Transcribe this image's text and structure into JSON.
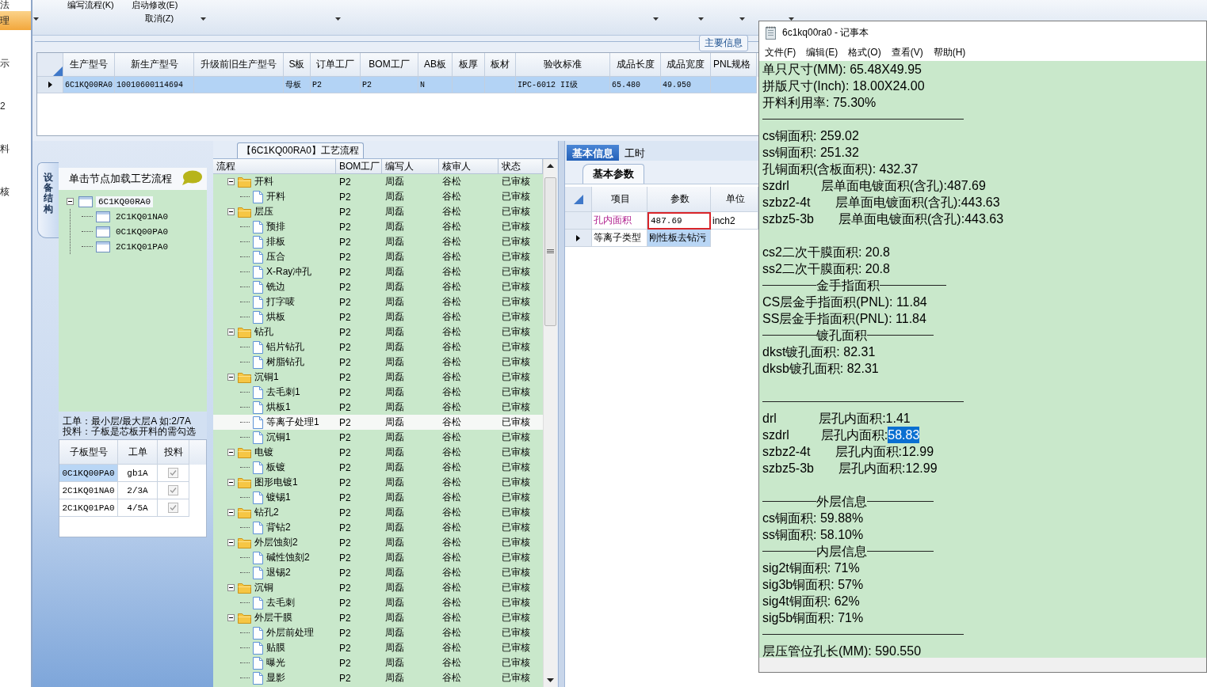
{
  "nav": {
    "items": [
      {
        "label": "法",
        "selected": false
      },
      {
        "label": "理",
        "selected": true
      },
      {
        "label": "示",
        "selected": false
      },
      {
        "label": "2",
        "selected": false
      },
      {
        "label": "料",
        "selected": false
      },
      {
        "label": "核",
        "selected": false
      }
    ]
  },
  "ribbon": {
    "commands": [
      "编写流程(K)",
      "启动修改(E)",
      "取消(Z)"
    ]
  },
  "main_info": {
    "title": "主要信息",
    "columns": [
      "生产型号",
      "新生产型号",
      "升级前旧生产型号",
      "S板",
      "订单工厂",
      "BOM工厂",
      "AB板",
      "板厚",
      "板材",
      "验收标准",
      "成品长度",
      "成品宽度",
      "PNL规格"
    ],
    "rows": [
      {
        "selected": true,
        "cells": [
          "6C1KQ00RA0",
          "10010600114694",
          null,
          "母板",
          "P2",
          "P2",
          "N",
          null,
          null,
          "IPC-6012 II级",
          "65.480",
          "49.950",
          null
        ]
      }
    ]
  },
  "structure_panel": {
    "tab": "设备结构",
    "hint": "单击节点加载工艺流程",
    "tree": [
      {
        "label": "6C1KQ00RA0",
        "expanded": true,
        "selected": true,
        "children": [
          {
            "label": "2C1KQ01NA0",
            "selected": false
          },
          {
            "label": "0C1KQ00PA0",
            "selected": false
          },
          {
            "label": "2C1KQ01PA0",
            "selected": false
          }
        ]
      }
    ],
    "note": [
      "工单：最小层/最大层A 如:2/7A",
      "投料：子板是芯板开料的需勾选"
    ],
    "grid": {
      "columns": [
        "子板型号",
        "工单",
        "投料"
      ],
      "rows": [
        {
          "board": "0C1KQ00PA0",
          "order": "gb1A",
          "checked": true,
          "selected": true
        },
        {
          "board": "2C1KQ01NA0",
          "order": "2/3A",
          "checked": true,
          "selected": false
        },
        {
          "board": "2C1KQ01PA0",
          "order": "4/5A",
          "checked": true,
          "selected": false
        }
      ]
    }
  },
  "process_panel": {
    "title": "【6C1KQ00RA0】工艺流程",
    "columns": [
      "流程",
      "BOM工厂",
      "编写人",
      "核审人",
      "状态"
    ],
    "rows": [
      {
        "label": "开料",
        "kind": "folder",
        "expanded": true,
        "bom": "P2",
        "author": "周磊",
        "reviewer": "谷松",
        "status": "已审核",
        "selected": false,
        "children": [
          {
            "label": "开料",
            "kind": "file",
            "bom": "P2",
            "author": "周磊",
            "reviewer": "谷松",
            "status": "已审核",
            "selected": false
          }
        ]
      },
      {
        "label": "层压",
        "kind": "folder",
        "expanded": true,
        "bom": "P2",
        "author": "周磊",
        "reviewer": "谷松",
        "status": "已审核",
        "selected": false,
        "children": [
          {
            "label": "预排",
            "kind": "file",
            "bom": "P2",
            "author": "周磊",
            "reviewer": "谷松",
            "status": "已审核",
            "selected": false
          },
          {
            "label": "排板",
            "kind": "file",
            "bom": "P2",
            "author": "周磊",
            "reviewer": "谷松",
            "status": "已审核",
            "selected": false
          },
          {
            "label": "压合",
            "kind": "file",
            "bom": "P2",
            "author": "周磊",
            "reviewer": "谷松",
            "status": "已审核",
            "selected": false
          },
          {
            "label": "X-Ray冲孔",
            "kind": "file",
            "bom": "P2",
            "author": "周磊",
            "reviewer": "谷松",
            "status": "已审核",
            "selected": false
          },
          {
            "label": "铣边",
            "kind": "file",
            "bom": "P2",
            "author": "周磊",
            "reviewer": "谷松",
            "status": "已审核",
            "selected": false
          },
          {
            "label": "打字唛",
            "kind": "file",
            "bom": "P2",
            "author": "周磊",
            "reviewer": "谷松",
            "status": "已审核",
            "selected": false
          },
          {
            "label": "烘板",
            "kind": "file",
            "bom": "P2",
            "author": "周磊",
            "reviewer": "谷松",
            "status": "已审核",
            "selected": false
          }
        ]
      },
      {
        "label": "钻孔",
        "kind": "folder",
        "expanded": true,
        "bom": "P2",
        "author": "周磊",
        "reviewer": "谷松",
        "status": "已审核",
        "selected": false,
        "children": [
          {
            "label": "铝片钻孔",
            "kind": "file",
            "bom": "P2",
            "author": "周磊",
            "reviewer": "谷松",
            "status": "已审核",
            "selected": false
          },
          {
            "label": "树脂钻孔",
            "kind": "file",
            "bom": "P2",
            "author": "周磊",
            "reviewer": "谷松",
            "status": "已审核",
            "selected": false
          }
        ]
      },
      {
        "label": "沉铜1",
        "kind": "folder",
        "expanded": true,
        "bom": "P2",
        "author": "周磊",
        "reviewer": "谷松",
        "status": "已审核",
        "selected": false,
        "children": [
          {
            "label": "去毛刺1",
            "kind": "file",
            "bom": "P2",
            "author": "周磊",
            "reviewer": "谷松",
            "status": "已审核",
            "selected": false
          },
          {
            "label": "烘板1",
            "kind": "file",
            "bom": "P2",
            "author": "周磊",
            "reviewer": "谷松",
            "status": "已审核",
            "selected": false
          },
          {
            "label": "等离子处理1",
            "kind": "file",
            "bom": "P2",
            "author": "周磊",
            "reviewer": "谷松",
            "status": "已审核",
            "selected": true
          },
          {
            "label": "沉铜1",
            "kind": "file",
            "bom": "P2",
            "author": "周磊",
            "reviewer": "谷松",
            "status": "已审核",
            "selected": false
          }
        ]
      },
      {
        "label": "电镀",
        "kind": "folder",
        "expanded": true,
        "bom": "P2",
        "author": "周磊",
        "reviewer": "谷松",
        "status": "已审核",
        "selected": false,
        "children": [
          {
            "label": "板镀",
            "kind": "file",
            "bom": "P2",
            "author": "周磊",
            "reviewer": "谷松",
            "status": "已审核",
            "selected": false
          }
        ]
      },
      {
        "label": "图形电镀1",
        "kind": "folder",
        "expanded": true,
        "bom": "P2",
        "author": "周磊",
        "reviewer": "谷松",
        "status": "已审核",
        "selected": false,
        "children": [
          {
            "label": "镀锡1",
            "kind": "file",
            "bom": "P2",
            "author": "周磊",
            "reviewer": "谷松",
            "status": "已审核",
            "selected": false
          }
        ]
      },
      {
        "label": "钻孔2",
        "kind": "folder",
        "expanded": true,
        "bom": "P2",
        "author": "周磊",
        "reviewer": "谷松",
        "status": "已审核",
        "selected": false,
        "children": [
          {
            "label": "背钻2",
            "kind": "file",
            "bom": "P2",
            "author": "周磊",
            "reviewer": "谷松",
            "status": "已审核",
            "selected": false
          }
        ]
      },
      {
        "label": "外层蚀刻2",
        "kind": "folder",
        "expanded": true,
        "bom": "P2",
        "author": "周磊",
        "reviewer": "谷松",
        "status": "已审核",
        "selected": false,
        "children": [
          {
            "label": "碱性蚀刻2",
            "kind": "file",
            "bom": "P2",
            "author": "周磊",
            "reviewer": "谷松",
            "status": "已审核",
            "selected": false
          },
          {
            "label": "退锡2",
            "kind": "file",
            "bom": "P2",
            "author": "周磊",
            "reviewer": "谷松",
            "status": "已审核",
            "selected": false
          }
        ]
      },
      {
        "label": "沉铜",
        "kind": "folder",
        "expanded": true,
        "bom": "P2",
        "author": "周磊",
        "reviewer": "谷松",
        "status": "已审核",
        "selected": false,
        "children": [
          {
            "label": "去毛刺",
            "kind": "file",
            "bom": "P2",
            "author": "周磊",
            "reviewer": "谷松",
            "status": "已审核",
            "selected": false
          }
        ]
      },
      {
        "label": "外层干膜",
        "kind": "folder",
        "expanded": true,
        "bom": "P2",
        "author": "周磊",
        "reviewer": "谷松",
        "status": "已审核",
        "selected": false,
        "children": [
          {
            "label": "外层前处理",
            "kind": "file",
            "bom": "P2",
            "author": "周磊",
            "reviewer": "谷松",
            "status": "已审核",
            "selected": false
          },
          {
            "label": "贴膜",
            "kind": "file",
            "bom": "P2",
            "author": "周磊",
            "reviewer": "谷松",
            "status": "已审核",
            "selected": false
          },
          {
            "label": "曝光",
            "kind": "file",
            "bom": "P2",
            "author": "周磊",
            "reviewer": "谷松",
            "status": "已审核",
            "selected": false
          },
          {
            "label": "显影",
            "kind": "file",
            "bom": "P2",
            "author": "周磊",
            "reviewer": "谷松",
            "status": "已审核",
            "selected": false
          }
        ]
      }
    ]
  },
  "param_panel": {
    "tabs": [
      {
        "label": "基本信息",
        "selected": true
      },
      {
        "label": "工时",
        "selected": false
      }
    ],
    "subtab": "基本参数",
    "columns": [
      "项目",
      "参数",
      "单位"
    ],
    "rows": [
      {
        "item": "孔内面积",
        "value": "487.69",
        "unit": "inch2",
        "modified": true,
        "editing": true,
        "current": false,
        "value_selected": false
      },
      {
        "item": "等离子类型",
        "value": "刚性板去钻污",
        "unit": null,
        "modified": false,
        "editing": false,
        "current": true,
        "value_selected": true
      }
    ]
  },
  "notepad": {
    "title": "6c1kq00ra0 - 记事本",
    "menu": [
      "文件(F)",
      "编辑(E)",
      "格式(O)",
      "查看(V)",
      "帮助(H)"
    ],
    "lines": [
      {
        "kind": "text",
        "text": "单只尺寸(MM): 65.48X49.95"
      },
      {
        "kind": "text",
        "text": "拼版尺寸(Inch): 18.00X24.00"
      },
      {
        "kind": "text",
        "text": "开料利用率: 75.30%"
      },
      {
        "kind": "rule"
      },
      {
        "kind": "text",
        "text": "cs铜面积: 259.02"
      },
      {
        "kind": "text",
        "text": "ss铜面积: 251.32"
      },
      {
        "kind": "text",
        "text": "孔铜面积(含板面积): 432.37"
      },
      {
        "kind": "text",
        "text": "szdrl         层单面电镀面积(含孔):487.69"
      },
      {
        "kind": "text",
        "text": "szbz2-4t       层单面电镀面积(含孔):443.63"
      },
      {
        "kind": "text",
        "text": "szbz5-3b       层单面电镀面积(含孔):443.63"
      },
      {
        "kind": "blank"
      },
      {
        "kind": "text",
        "text": "cs2二次干膜面积: 20.8"
      },
      {
        "kind": "text",
        "text": "ss2二次干膜面积: 20.8"
      },
      {
        "kind": "heading",
        "text": "金手指面积"
      },
      {
        "kind": "text",
        "text": "CS层金手指面积(PNL): 11.84"
      },
      {
        "kind": "text",
        "text": "SS层金手指面积(PNL): 11.84"
      },
      {
        "kind": "heading",
        "text": "镀孔面积"
      },
      {
        "kind": "text",
        "text": "dkst镀孔面积: 82.31"
      },
      {
        "kind": "text",
        "text": "dksb镀孔面积: 82.31"
      },
      {
        "kind": "blank"
      },
      {
        "kind": "rule"
      },
      {
        "kind": "text",
        "text": "drl            层孔内面积:1.41"
      },
      {
        "kind": "text",
        "text": "szdrl         层孔内面积:",
        "selection": "58.83"
      },
      {
        "kind": "text",
        "text": "szbz2-4t       层孔内面积:12.99"
      },
      {
        "kind": "text",
        "text": "szbz5-3b       层孔内面积:12.99"
      },
      {
        "kind": "blank"
      },
      {
        "kind": "heading",
        "text": "外层信息"
      },
      {
        "kind": "text",
        "text": "cs铜面积: 59.88%"
      },
      {
        "kind": "text",
        "text": "ss铜面积: 58.10%"
      },
      {
        "kind": "heading",
        "text": "内层信息"
      },
      {
        "kind": "text",
        "text": "sig2t铜面积: 71%"
      },
      {
        "kind": "text",
        "text": "sig3b铜面积: 57%"
      },
      {
        "kind": "text",
        "text": "sig4t铜面积: 62%"
      },
      {
        "kind": "text",
        "text": "sig5b铜面积: 71%"
      },
      {
        "kind": "rule"
      },
      {
        "kind": "text",
        "text": "层压管位孔长(MM): 590.550"
      }
    ]
  }
}
